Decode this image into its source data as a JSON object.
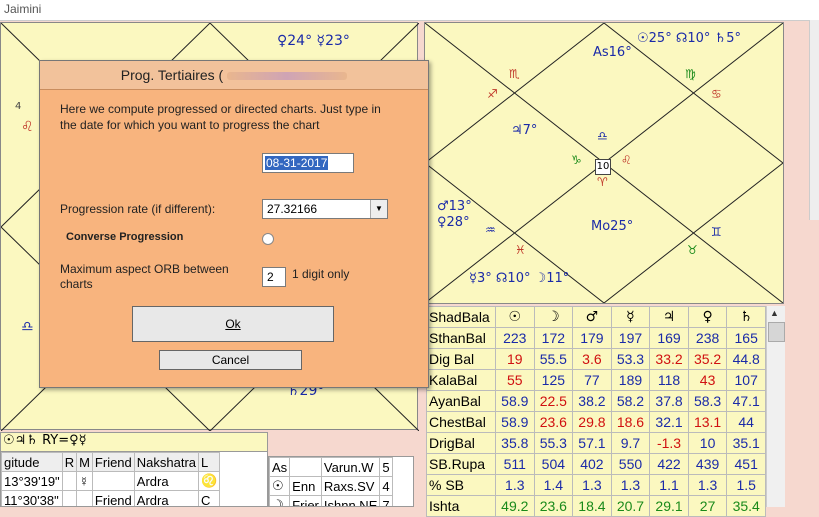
{
  "window": {
    "title": "Jaimini"
  },
  "left_chart": {
    "top_positions": "♀24° ☿23°",
    "house_number_4": "4",
    "bottom_right": "♄29°",
    "leo_sign": "♌",
    "libra_sign": "♎"
  },
  "right_chart": {
    "top_line": "☉25° ☊10° ♄5°",
    "asc": "As16°",
    "scorpio": "♏",
    "virgo": "♍",
    "sagittarius": "♐",
    "cancer_label": "♋",
    "jupiter": "♃7°",
    "libra": "♎",
    "capricorn": "♑",
    "house_box": "10",
    "leo": "♌",
    "aries": "♈",
    "mars": "♂13°",
    "venus": "♀28°",
    "moon": "Mo25°",
    "gemini": "♊",
    "aquarius": "♒",
    "pisces": "♓",
    "taurus": "♉",
    "bottom_line": "☿3° ☊10° ☽11°"
  },
  "dialog": {
    "title": "Prog. Tertiaires (",
    "intro": "Here we compute progressed or directed charts.  Just type in the date for which you want to progress the chart",
    "date_value": "08-31-2017",
    "rate_label": "Progression rate (if different):",
    "rate_value": "27.32166",
    "converse_label": "Converse Progression",
    "orb_label": "Maximum aspect ORB between charts",
    "orb_value": "2",
    "orb_hint": "1 digit only",
    "ok_label": "Ok",
    "cancel_label": "Cancel"
  },
  "shadbala": {
    "header": [
      "ShadBala",
      "☉",
      "☽",
      "♂",
      "☿",
      "♃",
      "♀",
      "♄"
    ],
    "rows": [
      {
        "label": "SthanBal",
        "values": [
          "223",
          "172",
          "179",
          "197",
          "169",
          "238",
          "165"
        ],
        "colors": [
          "blue",
          "blue",
          "blue",
          "blue",
          "blue",
          "blue",
          "blue"
        ]
      },
      {
        "label": "Dig Bal",
        "values": [
          "19",
          "55.5",
          "3.6",
          "53.3",
          "33.2",
          "35.2",
          "44.8"
        ],
        "colors": [
          "red",
          "blue",
          "red",
          "blue",
          "red",
          "red",
          "blue"
        ]
      },
      {
        "label": "KalaBal",
        "values": [
          "55",
          "125",
          "77",
          "189",
          "118",
          "43",
          "107"
        ],
        "colors": [
          "red",
          "blue",
          "blue",
          "blue",
          "blue",
          "red",
          "blue"
        ]
      },
      {
        "label": "AyanBal",
        "values": [
          "58.9",
          "22.5",
          "38.2",
          "58.2",
          "37.8",
          "58.3",
          "47.1"
        ],
        "colors": [
          "blue",
          "red",
          "blue",
          "blue",
          "blue",
          "blue",
          "blue"
        ]
      },
      {
        "label": "ChestBal",
        "values": [
          "58.9",
          "23.6",
          "29.8",
          "18.6",
          "32.1",
          "13.1",
          "44"
        ],
        "colors": [
          "blue",
          "red",
          "red",
          "red",
          "blue",
          "red",
          "blue"
        ]
      },
      {
        "label": "DrigBal",
        "values": [
          "35.8",
          "55.3",
          "57.1",
          "9.7",
          "-1.3",
          "10",
          "35.1"
        ],
        "colors": [
          "blue",
          "blue",
          "blue",
          "blue",
          "red",
          "blue",
          "blue"
        ]
      },
      {
        "label": "SB.Rupa",
        "values": [
          "511",
          "504",
          "402",
          "550",
          "422",
          "439",
          "451"
        ],
        "colors": [
          "blue",
          "blue",
          "blue",
          "blue",
          "blue",
          "blue",
          "blue"
        ]
      },
      {
        "label": "% SB",
        "values": [
          "1.3",
          "1.4",
          "1.3",
          "1.3",
          "1.1",
          "1.3",
          "1.5"
        ],
        "colors": [
          "blue",
          "blue",
          "blue",
          "blue",
          "blue",
          "blue",
          "blue"
        ]
      },
      {
        "label": "Ishta",
        "values": [
          "49.2",
          "23.6",
          "18.4",
          "20.7",
          "29.1",
          "27",
          "35.4"
        ],
        "colors": [
          "green",
          "green",
          "green",
          "green",
          "green",
          "green",
          "green"
        ]
      }
    ]
  },
  "bottom_left": {
    "symbols_line": "☉♃♄  RY=♀☿",
    "header": [
      "gitude",
      "R",
      "M",
      "Friend",
      "Nakshatra",
      "L"
    ],
    "rows": [
      [
        "13°39'19\"",
        "",
        "☿",
        "",
        "Ardra",
        "♌"
      ],
      [
        "11°30'38\"",
        "",
        "",
        "Friend",
        "Ardra",
        "C"
      ]
    ]
  },
  "bottom_mid": {
    "rows": [
      [
        "As",
        "",
        "Varun.W",
        "5"
      ],
      [
        "☉",
        "Enn",
        "Raxs.SV",
        "4"
      ],
      [
        "☽",
        "Frier",
        "Ishnn.NE",
        "7"
      ]
    ]
  }
}
